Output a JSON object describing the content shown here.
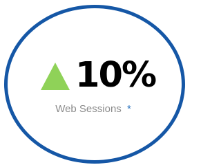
{
  "card": {
    "trend_icon": "triangle-up-icon",
    "value": "10%",
    "label": "Web Sessions",
    "footnote_marker": "*"
  },
  "colors": {
    "border": "#1557a6",
    "trend_up": "#8fd258",
    "value_text": "#000000",
    "label_text": "#8b8b8b",
    "footnote": "#2b74bf"
  }
}
